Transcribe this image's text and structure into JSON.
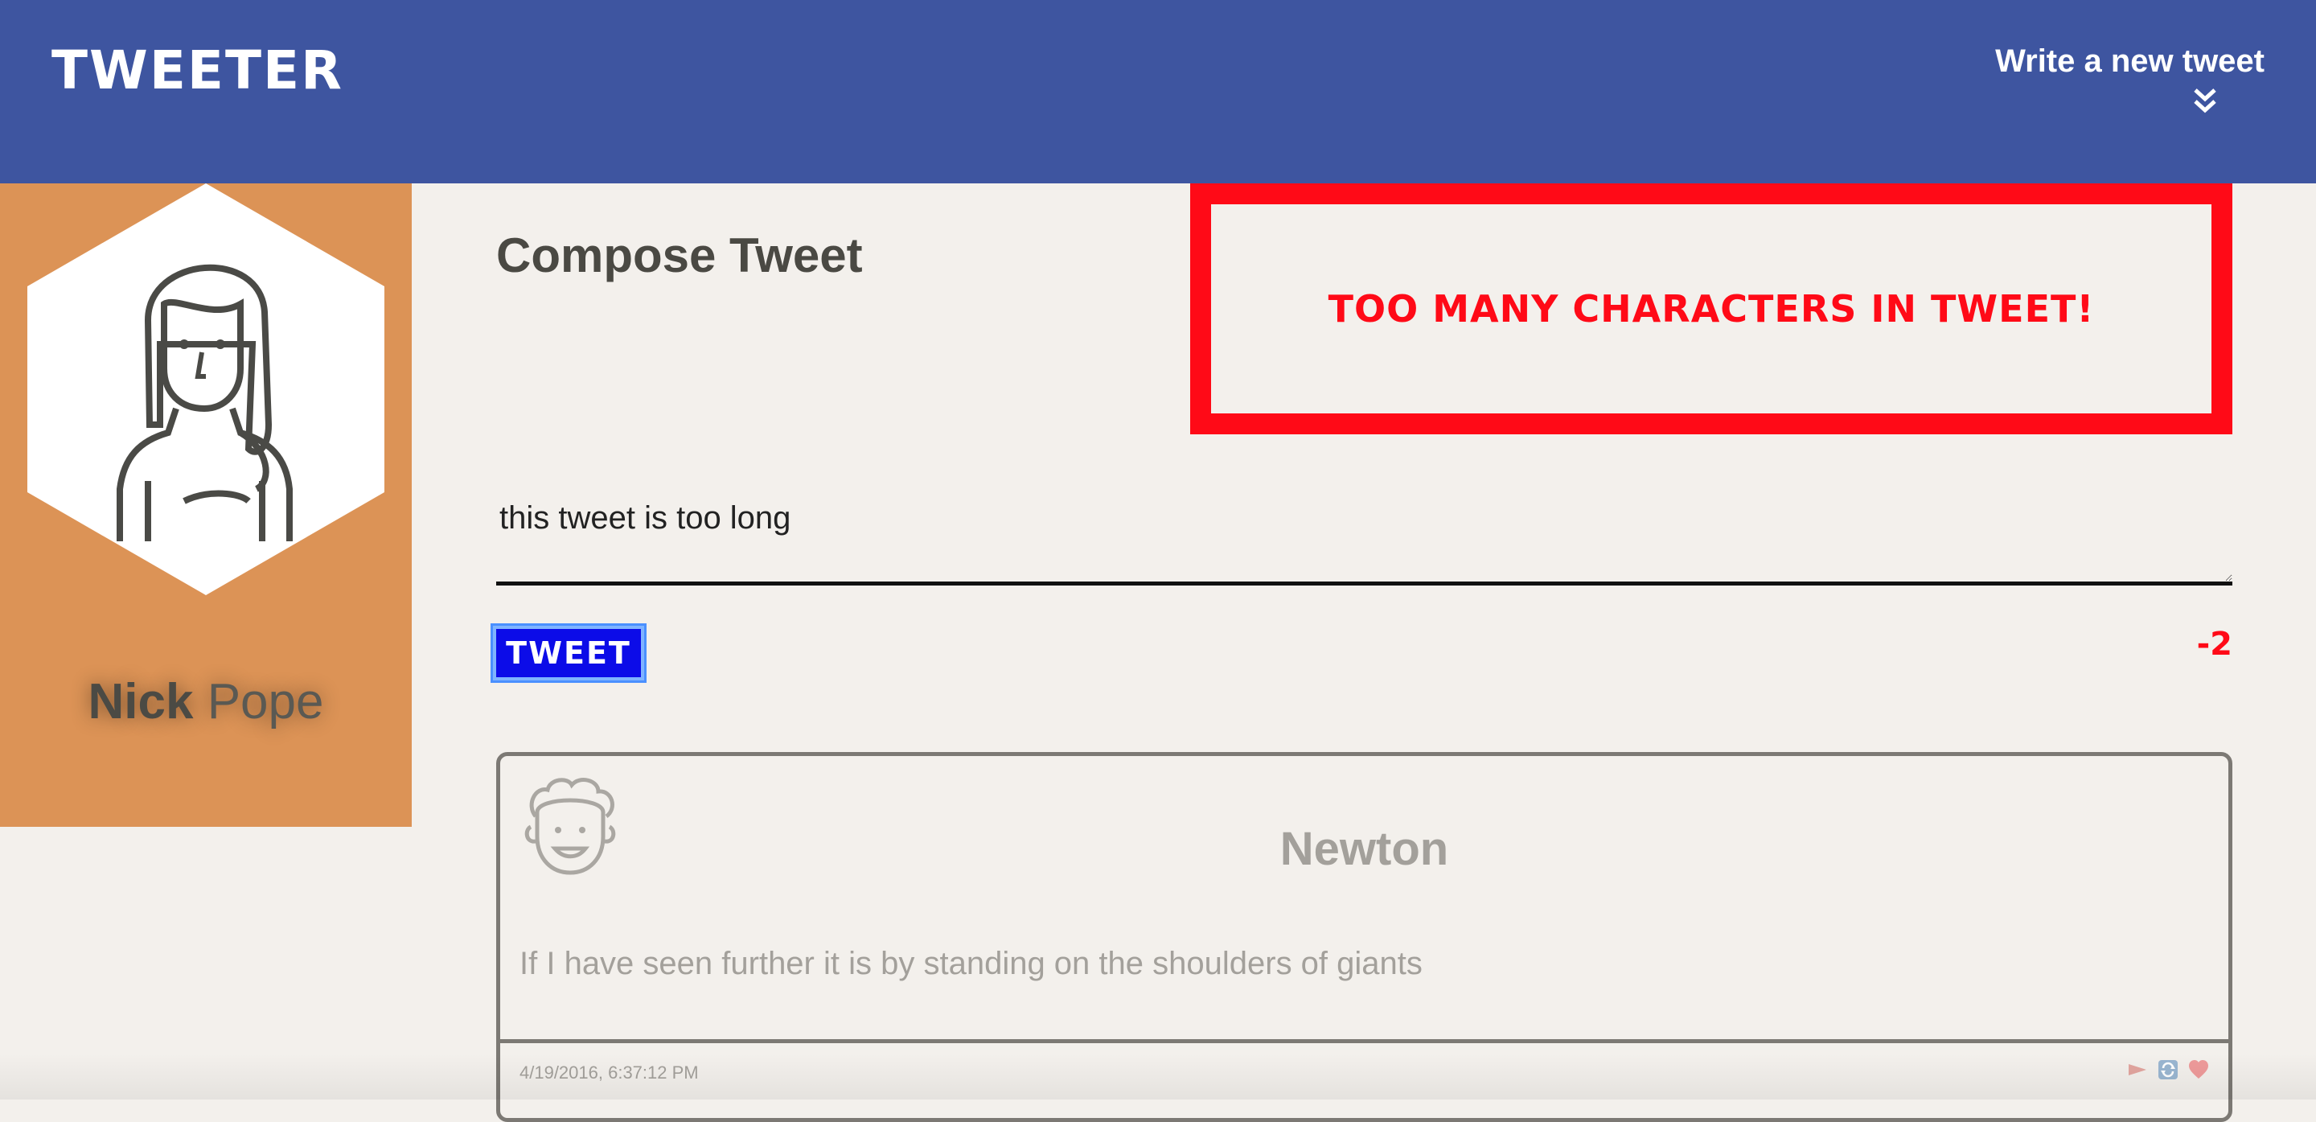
{
  "nav": {
    "brand": "TWEETER",
    "compose_toggle_label": "Write a new tweet",
    "compose_toggle_icon": "double-chevron-down-icon"
  },
  "profile": {
    "first_name": "Nick",
    "last_name": "Pope",
    "avatar_icon": "user-avatar-icon"
  },
  "compose": {
    "title": "Compose Tweet",
    "error": "Too many characters in tweet!",
    "input_value": "this tweet is too long",
    "button_label": "Tweet",
    "char_counter": "-2"
  },
  "tweets": [
    {
      "author": "Newton",
      "avatar_icon": "user-avatar-icon",
      "content": "If I have seen further it is by standing on the shoulders of giants",
      "timestamp": "4/19/2016, 6:37:12 PM",
      "actions": [
        "flag-icon",
        "retweet-icon",
        "heart-icon"
      ]
    }
  ],
  "colors": {
    "navbar": "#3e55a0",
    "profile_bg": "#dc9356",
    "error": "#ff0a17",
    "button": "#0c0ce8",
    "page_bg": "#f3f0ec"
  }
}
